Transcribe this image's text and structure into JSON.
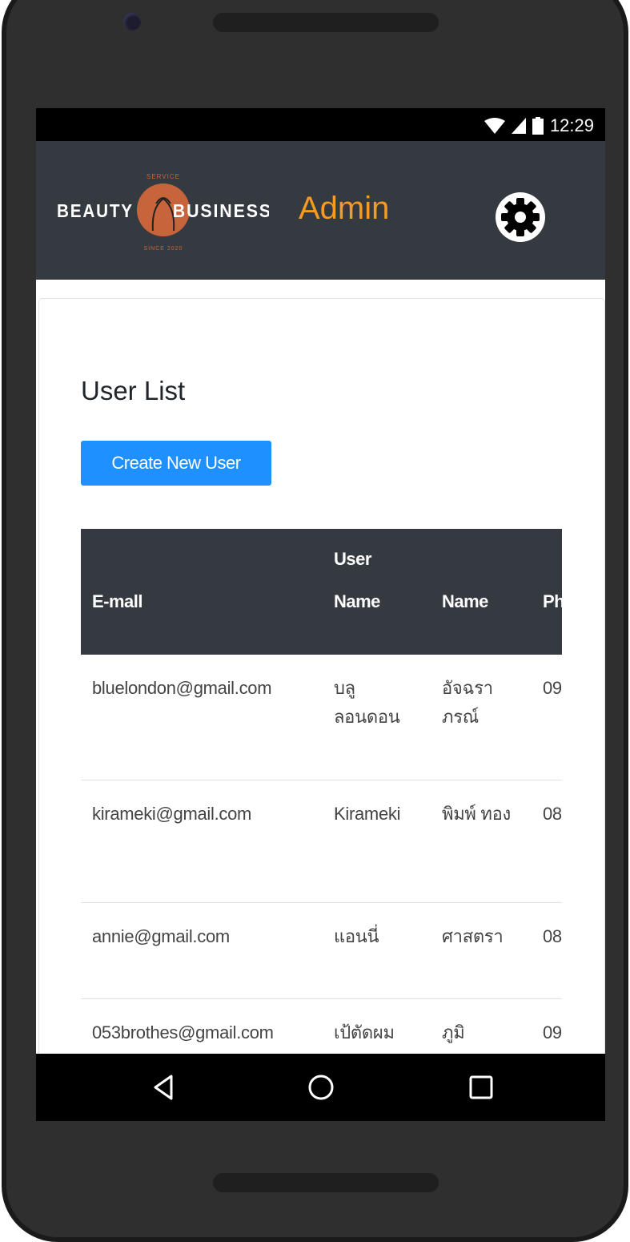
{
  "status_bar": {
    "time": "12:29",
    "icons": [
      "wifi-icon",
      "signal-icon",
      "battery-icon"
    ]
  },
  "app_bar": {
    "logo": {
      "top_text": "SERVICE",
      "left_word": "BEAUTY",
      "right_word": "BUSINESS",
      "bottom_text": "SINCE 2020"
    },
    "title": "Admin",
    "settings_icon": "gear-icon"
  },
  "main": {
    "page_title": "User List",
    "create_button": "Create New User",
    "table": {
      "headers": [
        "E-mall",
        "User Name",
        "Name",
        "Ph Nu"
      ],
      "rows": [
        [
          "bluelondon@gmail.com",
          "บลู ลอนดอน",
          "อัจฉรา ภรณ์",
          "09"
        ],
        [
          "kirameki@gmail.com",
          "Kirameki",
          "พิมพ์ ทอง",
          "08"
        ],
        [
          "annie@gmail.com",
          "แอนนี่",
          "ศาสตรา",
          "08"
        ],
        [
          "053brothes@gmail.com",
          "เป้ตัดผม",
          "ภูมิ",
          "09"
        ]
      ]
    }
  },
  "nav_bar": {
    "icons": [
      "back-icon",
      "home-icon",
      "recents-icon"
    ]
  },
  "colors": {
    "app_bar": "#343a40",
    "accent": "#f59a23",
    "button": "#1e90ff",
    "logo_circle": "#c8643c"
  }
}
